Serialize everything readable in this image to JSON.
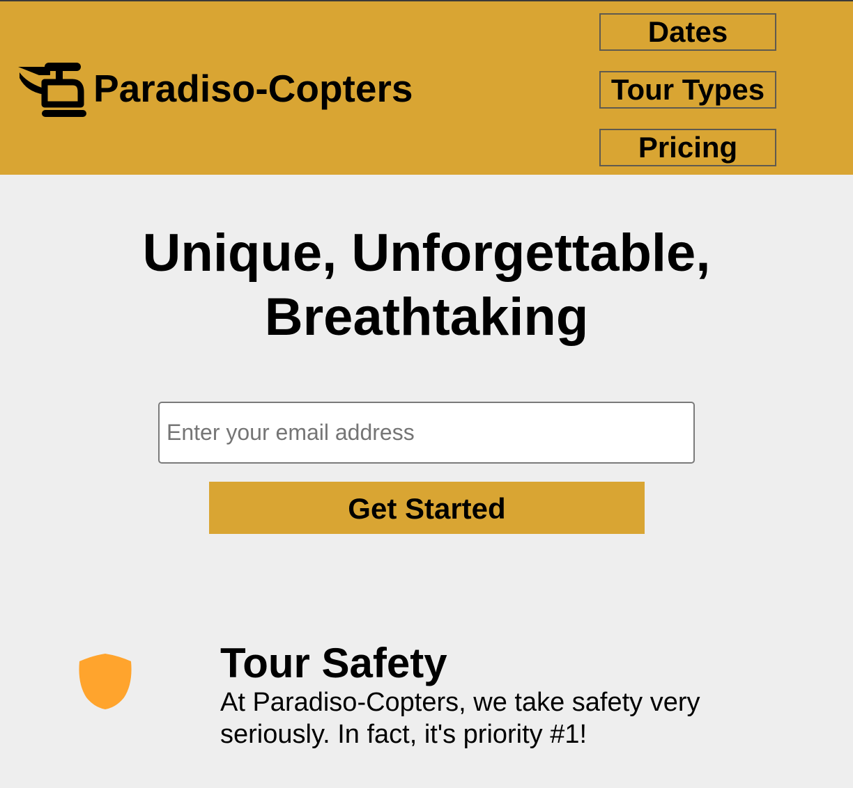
{
  "header": {
    "brand_name": "Paradiso-Copters",
    "logo_icon": "helicopter-icon",
    "nav": [
      {
        "label": "Dates"
      },
      {
        "label": "Tour Types"
      },
      {
        "label": "Pricing"
      }
    ]
  },
  "hero": {
    "title_line1": "Unique, Unforgettable,",
    "title_line2": "Breathtaking",
    "email_placeholder": "Enter your email address",
    "email_value": "",
    "cta_label": "Get Started"
  },
  "features": [
    {
      "icon": "shield-icon",
      "title": "Tour Safety",
      "text": "At Paradiso-Copters, we take safety very seriously. In fact, it's priority #1!"
    }
  ],
  "colors": {
    "accent": "#d9a533",
    "background": "#eeeeee",
    "shield": "#ffa42d"
  }
}
